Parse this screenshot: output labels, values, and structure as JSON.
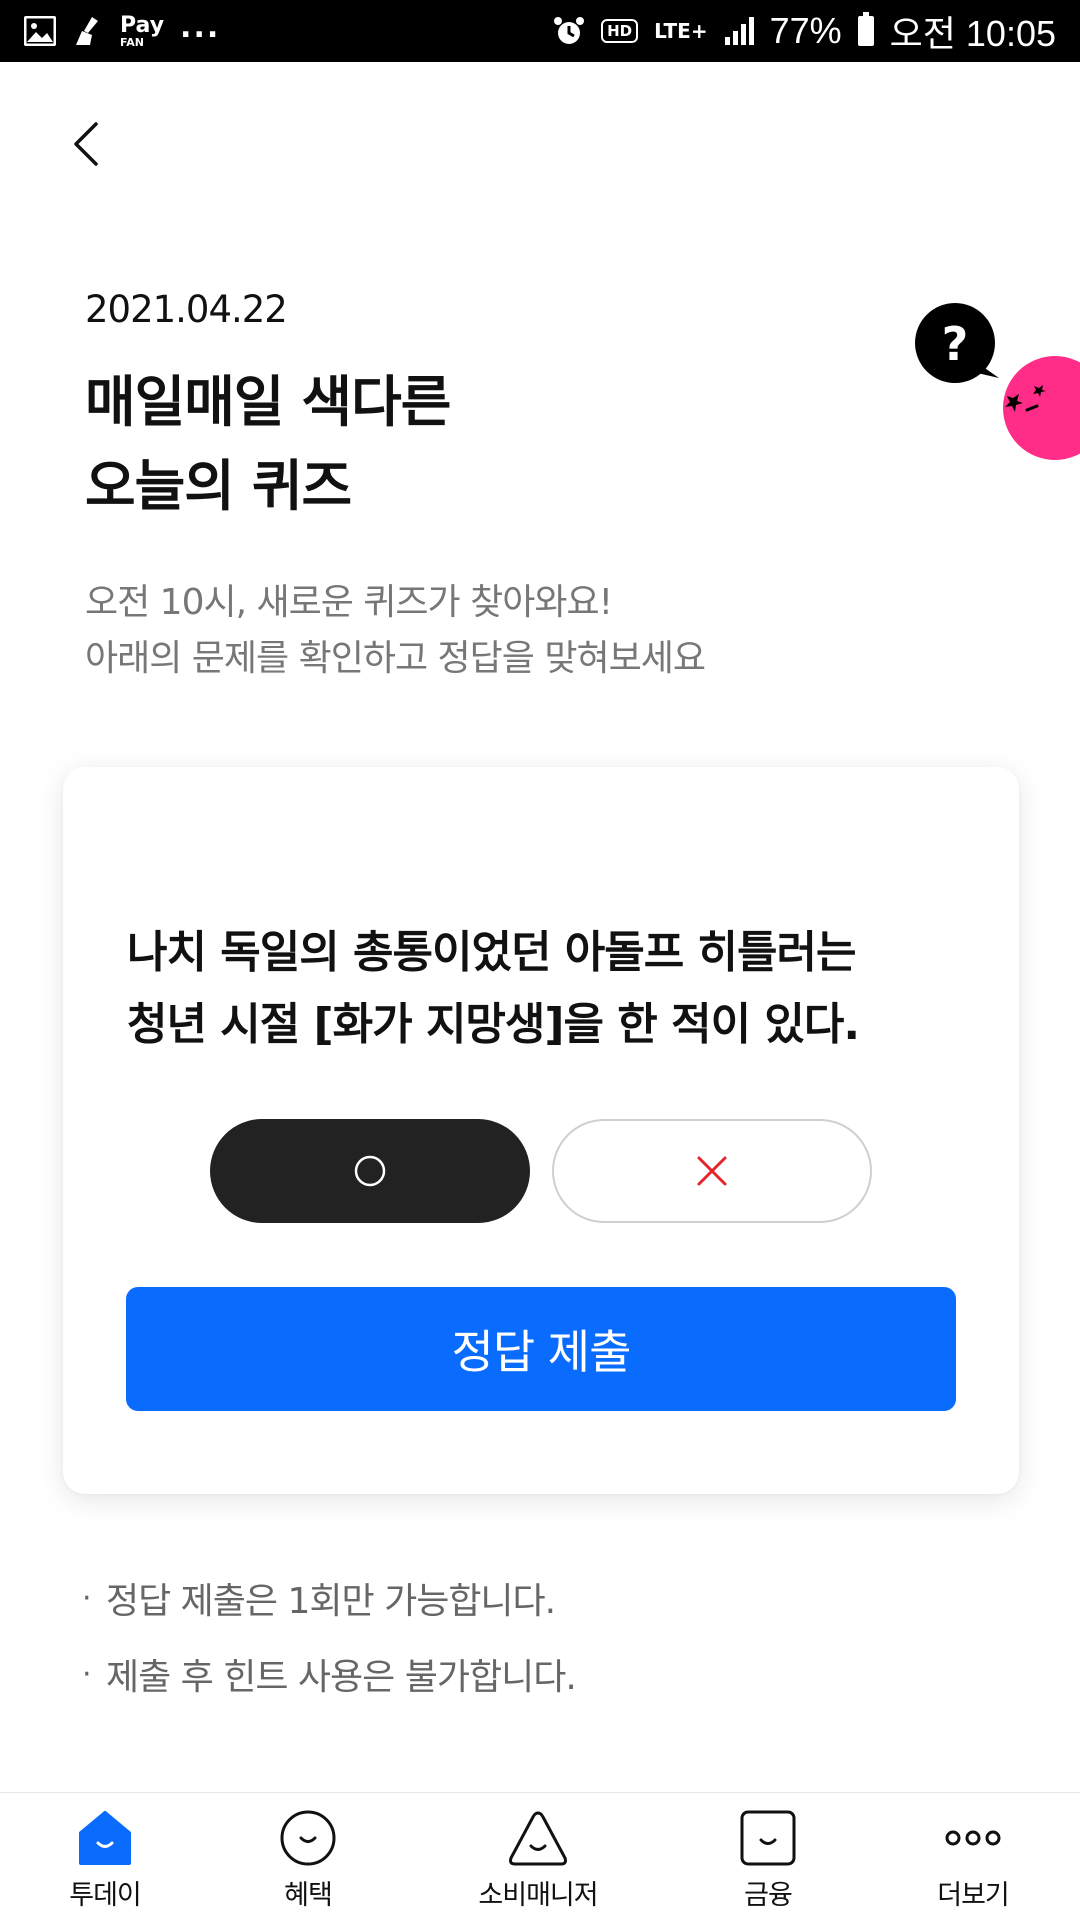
{
  "status_bar": {
    "pay_label": "Pay",
    "pay_sub": "FAN",
    "more": "...",
    "hd": "HD",
    "lte": "LTE+",
    "battery": "77%",
    "time": "오전 10:05"
  },
  "header": {
    "date": "2021.04.22",
    "title_line1": "매일매일 색다른",
    "title_line2": "오늘의 퀴즈",
    "subtitle_line1": "오전 10시, 새로운 퀴즈가 찾아와요!",
    "subtitle_line2": "아래의 문제를 확인하고 정답을 맞혀보세요"
  },
  "quiz": {
    "question_line1": "나치 독일의 총통이었던 아돌프 히틀러는",
    "question_line2": "청년 시절 [화가 지망생]을 한 적이 있다.",
    "selected": "O",
    "submit_label": "정답 제출"
  },
  "notes": [
    "정답 제출은 1회만 가능합니다.",
    "제출 후 힌트 사용은 불가합니다."
  ],
  "bottom_nav": {
    "items": [
      {
        "label": "투데이",
        "icon": "home-smile-icon",
        "active": true
      },
      {
        "label": "혜택",
        "icon": "circle-smile-icon",
        "active": false
      },
      {
        "label": "소비매니저",
        "icon": "triangle-smile-icon",
        "active": false
      },
      {
        "label": "금융",
        "icon": "square-smile-icon",
        "active": false
      },
      {
        "label": "더보기",
        "icon": "more-dots-icon",
        "active": false
      }
    ]
  },
  "colors": {
    "accent": "#0a6cff",
    "o_button": "#222222",
    "x_mark": "#e4262c",
    "mascot": "#ff2d87"
  }
}
